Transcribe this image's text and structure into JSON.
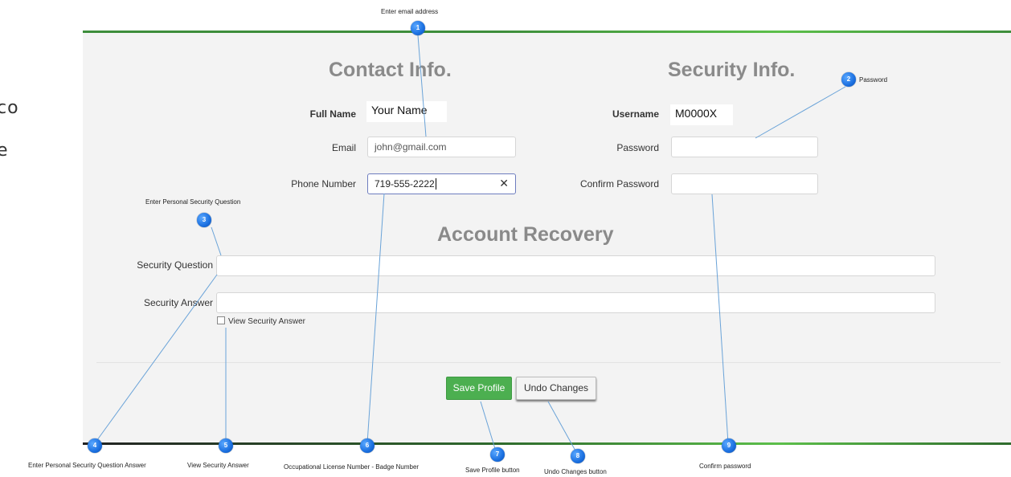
{
  "sidebar_fragments": {
    "line1": "co",
    "line2": "e"
  },
  "contact": {
    "title": "Contact Info.",
    "full_name_label": "Full Name",
    "full_name_value": "Your Name",
    "email_label": "Email",
    "email_value": "john@gmail.com",
    "phone_label": "Phone Number",
    "phone_value": "719-555-2222",
    "clear_glyph": "✕"
  },
  "security": {
    "title": "Security Info.",
    "username_label": "Username",
    "username_value": "M0000X",
    "password_label": "Password",
    "password_value": "",
    "confirm_label": "Confirm Password",
    "confirm_value": ""
  },
  "recovery": {
    "title": "Account Recovery",
    "question_label": "Security Question",
    "question_value": "",
    "answer_label": "Security Answer",
    "answer_value": "",
    "view_answer_label": "View Security Answer",
    "view_answer_checked": false
  },
  "actions": {
    "save_label": "Save Profile",
    "undo_label": "Undo Changes"
  },
  "callouts": [
    {
      "number": "1",
      "text": "Enter email address"
    },
    {
      "number": "2",
      "text": "Password"
    },
    {
      "number": "3",
      "text": "Enter Personal Security Question"
    },
    {
      "number": "4",
      "text": "Enter Personal Security Question Answer"
    },
    {
      "number": "5",
      "text": "View Security Answer"
    },
    {
      "number": "6",
      "text": "Occupational License Number - Badge Number"
    },
    {
      "number": "7",
      "text": "Save Profile button"
    },
    {
      "number": "8",
      "text": "Undo Changes button"
    },
    {
      "number": "9",
      "text": "Confirm password"
    }
  ],
  "colors": {
    "accent_green": "#4caf50",
    "border_green": "#3d8d3b",
    "badge_blue": "#1a6fe0",
    "connector_blue": "#6aa3d8",
    "panel_bg": "#f3f3f3",
    "title_gray": "#8a8a8a"
  }
}
